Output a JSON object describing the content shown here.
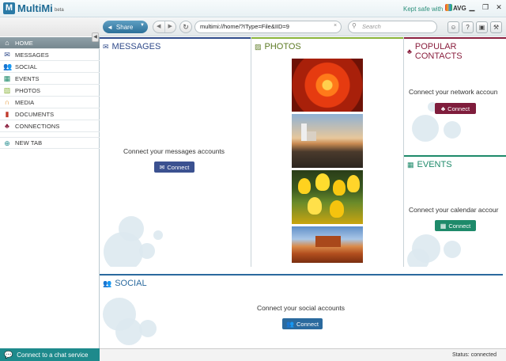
{
  "window": {
    "app_name": "MultiMi",
    "app_badge": "beta",
    "kept_safe": "Kept safe with",
    "avg_label": "AVG"
  },
  "sidebar": {
    "items": [
      {
        "label": "HOME",
        "icon": "home-icon",
        "active": true
      },
      {
        "label": "MESSAGES",
        "icon": "envelope-icon"
      },
      {
        "label": "SOCIAL",
        "icon": "people-icon"
      },
      {
        "label": "EVENTS",
        "icon": "calendar-icon"
      },
      {
        "label": "PHOTOS",
        "icon": "picture-icon"
      },
      {
        "label": "MEDIA",
        "icon": "headphones-icon"
      },
      {
        "label": "DOCUMENTS",
        "icon": "document-icon"
      },
      {
        "label": "CONNECTIONS",
        "icon": "network-icon"
      }
    ],
    "new_tab": "NEW TAB",
    "chat": "Connect to a chat service"
  },
  "toolbar": {
    "share": "Share",
    "address": "multimi://home/?IType=File&IID=9",
    "search_placeholder": "Search"
  },
  "panels": {
    "messages": {
      "title": "MESSAGES",
      "text": "Connect your messages accounts",
      "button": "Connect",
      "color": "#2f4a8a"
    },
    "photos": {
      "title": "PHOTOS",
      "color": "#8ab33a"
    },
    "contacts": {
      "title": "POPULAR CONTACTS",
      "text": "Connect your network accoun",
      "button": "Connect",
      "color": "#8a1f3e"
    },
    "events": {
      "title": "EVENTS",
      "text": "Connect your calendar accour",
      "button": "Connect",
      "color": "#1e8a6a"
    },
    "social": {
      "title": "SOCIAL",
      "text": "Connect your social accounts",
      "button": "Connect",
      "color": "#2b6a9e"
    }
  },
  "status": {
    "text": "Status: connected"
  }
}
